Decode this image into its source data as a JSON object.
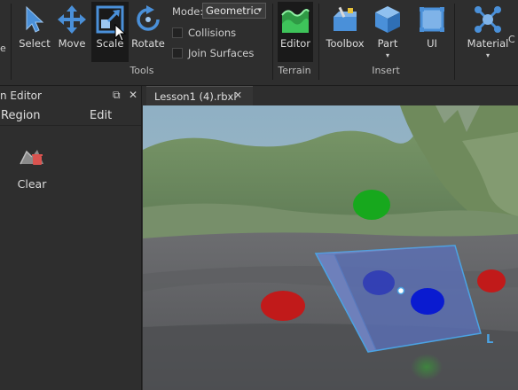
{
  "ribbon": {
    "tools": {
      "select": "Select",
      "move": "Move",
      "scale": "Scale",
      "rotate": "Rotate",
      "group_label": "Tools"
    },
    "mode": {
      "label": "Mode:",
      "value": "Geometric"
    },
    "collisions": {
      "label": "Collisions",
      "checked": false
    },
    "join_surfaces": {
      "label": "Join Surfaces",
      "checked": false
    },
    "terrain": {
      "editor": "Editor",
      "group_label": "Terrain"
    },
    "insert": {
      "toolbox": "Toolbox",
      "part": "Part",
      "ui": "UI",
      "group_label": "Insert"
    },
    "material": {
      "label": "Material"
    },
    "colors": {
      "accent": "#4a90d9",
      "terrain_green": "#3ec35a"
    }
  },
  "left_panel": {
    "title": "n Editor",
    "tabs": {
      "region": "Region",
      "edit": "Edit"
    },
    "clear_label": "Clear"
  },
  "document_tabs": [
    {
      "label": "Lesson1 (4).rbxl",
      "active": true
    }
  ],
  "viewport": {
    "scene": "3D terrain view with a selected transparent blue box and colored spheres",
    "selection_color": "#4ba3e3"
  }
}
